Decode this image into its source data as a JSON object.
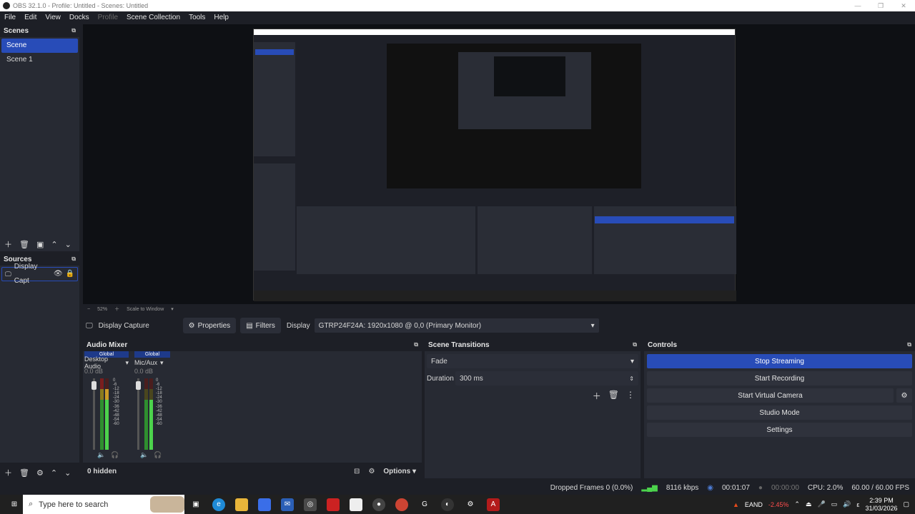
{
  "window": {
    "title": "OBS 32.1.0 - Profile: Untitled - Scenes: Untitled"
  },
  "menu": [
    "File",
    "Edit",
    "View",
    "Docks",
    "Profile",
    "Scene Collection",
    "Tools",
    "Help"
  ],
  "scenes": {
    "title": "Scenes",
    "items": [
      "Scene",
      "Scene 1"
    ],
    "selected": "Scene"
  },
  "sources": {
    "title": "Sources",
    "items": [
      {
        "label": "Display Capt"
      }
    ]
  },
  "zoom": {
    "value": "52%",
    "mode": "Scale to Window"
  },
  "source_toolbar": {
    "source_name": "Display Capture",
    "properties_label": "Properties",
    "filters_label": "Filters",
    "display_label": "Display",
    "display_value": "GTRP24F24A: 1920x1080 @ 0,0 (Primary Monitor)"
  },
  "audio_mixer": {
    "title": "Audio Mixer",
    "channels": [
      {
        "scope": "Global",
        "name": "Desktop Audio",
        "db": "0.0 dB"
      },
      {
        "scope": "Global",
        "name": "Mic/Aux",
        "db": "0.0 dB"
      }
    ],
    "scale": [
      "0",
      "-6",
      "-12",
      "-18",
      "-24",
      "-30",
      "-36",
      "-42",
      "-48",
      "-54",
      "-60"
    ],
    "hidden_label": "0 hidden",
    "options_label": "Options"
  },
  "transitions": {
    "title": "Scene Transitions",
    "selected": "Fade",
    "duration_label": "Duration",
    "duration_value": "300 ms"
  },
  "controls": {
    "title": "Controls",
    "buttons": [
      "Stop Streaming",
      "Start Recording",
      "Start Virtual Camera",
      "Studio Mode",
      "Settings"
    ]
  },
  "status": {
    "dropped": "Dropped Frames 0 (0.0%)",
    "bitrate": "8116 kbps",
    "stream_time": "00:01:07",
    "rec_time": "00:00:00",
    "cpu": "CPU: 2.0%",
    "fps": "60.00 / 60.00 FPS"
  },
  "taskbar": {
    "search_placeholder": "Type here to search",
    "ticker": "EAND",
    "ticker_change": "-2.45%",
    "time": "2:39 PM",
    "date": "31/03/2026"
  },
  "colors": {
    "accent": "#284cb8",
    "background": "#1d1f26",
    "panel": "#272a33",
    "ticker_down": "#ff4d4d"
  }
}
